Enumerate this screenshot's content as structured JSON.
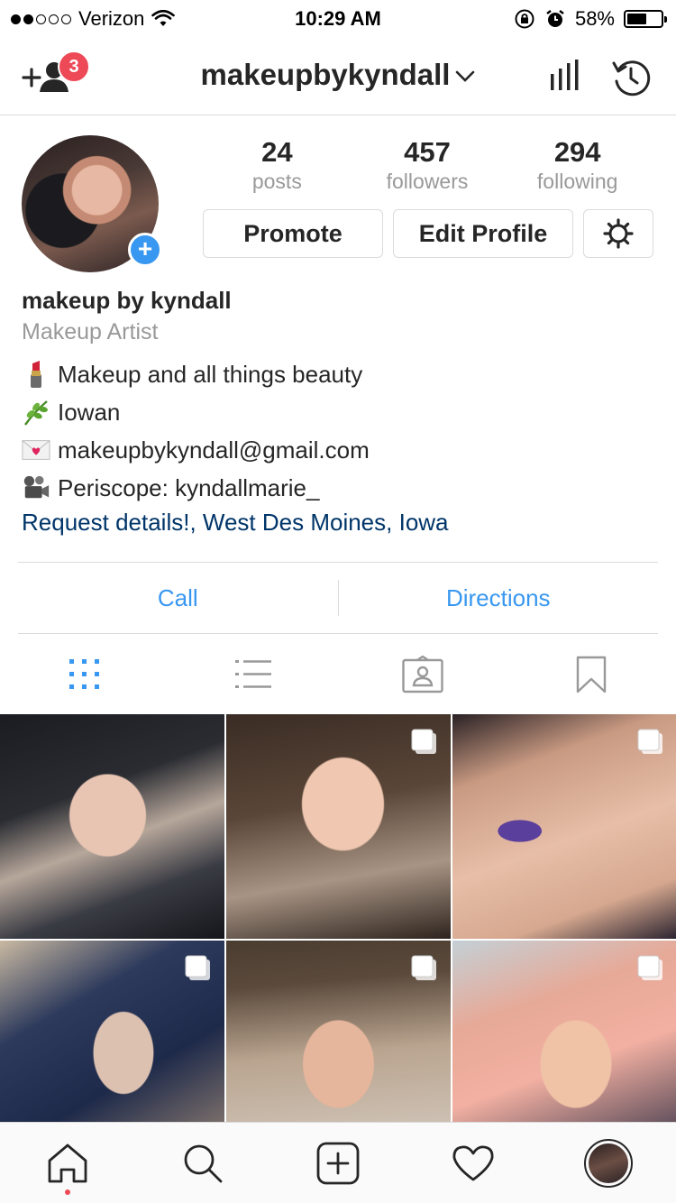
{
  "status_bar": {
    "carrier": "Verizon",
    "time": "10:29 AM",
    "battery": "58%",
    "battery_level": 0.58,
    "signal_bars_filled": 2,
    "signal_bars_total": 5
  },
  "header": {
    "username": "makeupbykyndall",
    "notification_count": "3",
    "icons": [
      "add-user-icon",
      "chevron-down-icon",
      "insights-icon",
      "history-icon"
    ]
  },
  "profile": {
    "counts": [
      {
        "value": "24",
        "label": "posts"
      },
      {
        "value": "457",
        "label": "followers"
      },
      {
        "value": "294",
        "label": "following"
      }
    ],
    "buttons": {
      "promote": "Promote",
      "edit_profile": "Edit Profile"
    }
  },
  "bio": {
    "name": "makeup by kyndall",
    "category": "Makeup Artist",
    "lines": [
      {
        "emoji": "lipstick",
        "text": "Makeup and all things beauty"
      },
      {
        "emoji": "herb",
        "text": "Iowan"
      },
      {
        "emoji": "love-letter",
        "text": "makeupbykyndall@gmail.com"
      },
      {
        "emoji": "film-projector",
        "text": "Periscope: kyndallmarie_"
      }
    ],
    "location": "Request details!, West Des Moines, Iowa"
  },
  "actions": {
    "call": "Call",
    "directions": "Directions"
  },
  "tabs": [
    "grid-view",
    "list-view",
    "tagged",
    "saved"
  ],
  "colors": {
    "accent_blue": "#3897f0",
    "link_dark_blue": "#003569",
    "badge_red": "#ed4956",
    "text": "#262626",
    "muted": "#999999",
    "border": "#dbdbdb"
  }
}
